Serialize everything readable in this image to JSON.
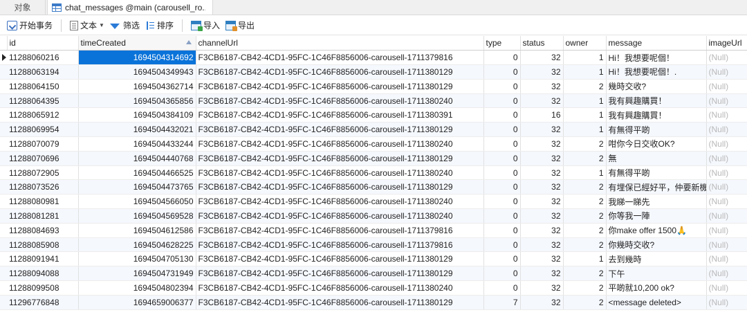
{
  "tabs": {
    "objects_label": "对象",
    "active_label": "chat_messages @main (carousell_ro..."
  },
  "toolbar": {
    "begin_tx": "开始事务",
    "text": "文本",
    "filter": "筛选",
    "sort": "排序",
    "import": "导入",
    "export": "导出"
  },
  "columns": [
    "id",
    "timeCreated",
    "channelUrl",
    "type",
    "status",
    "owner",
    "message",
    "imageUrl"
  ],
  "rows": [
    {
      "id": "11288060216",
      "timeCreated": "1694504314692",
      "channelUrl": "F3CB6187-CB42-4CD1-95FC-1C46F8856006-carousell-1711379816",
      "type": "0",
      "status": "32",
      "owner": "1",
      "message": "Hi！我想要呢個！",
      "imageUrl": "(Null)"
    },
    {
      "id": "11288063194",
      "timeCreated": "1694504349943",
      "channelUrl": "F3CB6187-CB42-4CD1-95FC-1C46F8856006-carousell-1711380129",
      "type": "0",
      "status": "32",
      "owner": "1",
      "message": "Hi！我想要呢個！.",
      "imageUrl": "(Null)"
    },
    {
      "id": "11288064150",
      "timeCreated": "1694504362714",
      "channelUrl": "F3CB6187-CB42-4CD1-95FC-1C46F8856006-carousell-1711380129",
      "type": "0",
      "status": "32",
      "owner": "2",
      "message": "幾時交收?",
      "imageUrl": "(Null)"
    },
    {
      "id": "11288064395",
      "timeCreated": "1694504365856",
      "channelUrl": "F3CB6187-CB42-4CD1-95FC-1C46F8856006-carousell-1711380240",
      "type": "0",
      "status": "32",
      "owner": "1",
      "message": "我有興趣購買！",
      "imageUrl": "(Null)"
    },
    {
      "id": "11288065912",
      "timeCreated": "1694504384109",
      "channelUrl": "F3CB6187-CB42-4CD1-95FC-1C46F8856006-carousell-1711380391",
      "type": "0",
      "status": "16",
      "owner": "1",
      "message": "我有興趣購買！",
      "imageUrl": "(Null)"
    },
    {
      "id": "11288069954",
      "timeCreated": "1694504432021",
      "channelUrl": "F3CB6187-CB42-4CD1-95FC-1C46F8856006-carousell-1711380129",
      "type": "0",
      "status": "32",
      "owner": "1",
      "message": "有無得平啲",
      "imageUrl": "(Null)"
    },
    {
      "id": "11288070079",
      "timeCreated": "1694504433244",
      "channelUrl": "F3CB6187-CB42-4CD1-95FC-1C46F8856006-carousell-1711380240",
      "type": "0",
      "status": "32",
      "owner": "2",
      "message": "咁你今日交收OK?",
      "imageUrl": "(Null)"
    },
    {
      "id": "11288070696",
      "timeCreated": "1694504440768",
      "channelUrl": "F3CB6187-CB42-4CD1-95FC-1C46F8856006-carousell-1711380129",
      "type": "0",
      "status": "32",
      "owner": "2",
      "message": "無",
      "imageUrl": "(Null)"
    },
    {
      "id": "11288072905",
      "timeCreated": "1694504466525",
      "channelUrl": "F3CB6187-CB42-4CD1-95FC-1C46F8856006-carousell-1711380240",
      "type": "0",
      "status": "32",
      "owner": "1",
      "message": "有無得平啲",
      "imageUrl": "(Null)"
    },
    {
      "id": "11288073526",
      "timeCreated": "1694504473765",
      "channelUrl": "F3CB6187-CB42-4CD1-95FC-1C46F8856006-carousell-1711380129",
      "type": "0",
      "status": "32",
      "owner": "2",
      "message": "有埋保已經好平，仲要新機",
      "imageUrl": "(Null)"
    },
    {
      "id": "11288080981",
      "timeCreated": "1694504566050",
      "channelUrl": "F3CB6187-CB42-4CD1-95FC-1C46F8856006-carousell-1711380240",
      "type": "0",
      "status": "32",
      "owner": "2",
      "message": "我睇一睇先",
      "imageUrl": "(Null)"
    },
    {
      "id": "11288081281",
      "timeCreated": "1694504569528",
      "channelUrl": "F3CB6187-CB42-4CD1-95FC-1C46F8856006-carousell-1711380240",
      "type": "0",
      "status": "32",
      "owner": "2",
      "message": "你等我一陣",
      "imageUrl": "(Null)"
    },
    {
      "id": "11288084693",
      "timeCreated": "1694504612586",
      "channelUrl": "F3CB6187-CB42-4CD1-95FC-1C46F8856006-carousell-1711379816",
      "type": "0",
      "status": "32",
      "owner": "2",
      "message": "你make offer 1500🙏",
      "imageUrl": "(Null)"
    },
    {
      "id": "11288085908",
      "timeCreated": "1694504628225",
      "channelUrl": "F3CB6187-CB42-4CD1-95FC-1C46F8856006-carousell-1711379816",
      "type": "0",
      "status": "32",
      "owner": "2",
      "message": "你幾時交收?",
      "imageUrl": "(Null)"
    },
    {
      "id": "11288091941",
      "timeCreated": "1694504705130",
      "channelUrl": "F3CB6187-CB42-4CD1-95FC-1C46F8856006-carousell-1711380129",
      "type": "0",
      "status": "32",
      "owner": "1",
      "message": "去到幾時",
      "imageUrl": "(Null)"
    },
    {
      "id": "11288094088",
      "timeCreated": "1694504731949",
      "channelUrl": "F3CB6187-CB42-4CD1-95FC-1C46F8856006-carousell-1711380129",
      "type": "0",
      "status": "32",
      "owner": "2",
      "message": "下午",
      "imageUrl": "(Null)"
    },
    {
      "id": "11288099508",
      "timeCreated": "1694504802394",
      "channelUrl": "F3CB6187-CB42-4CD1-95FC-1C46F8856006-carousell-1711380240",
      "type": "0",
      "status": "32",
      "owner": "2",
      "message": "平啲就10,200 ok?",
      "imageUrl": "(Null)"
    },
    {
      "id": "11296776848",
      "timeCreated": "1694659006377",
      "channelUrl": "F3CB6187-CB42-4CD1-95FC-1C46F8856006-carousell-1711380129",
      "type": "7",
      "status": "32",
      "owner": "2",
      "message": "<message deleted>",
      "imageUrl": "(Null)"
    }
  ],
  "colors": {
    "selection": "#0a73d9",
    "null_text": "#b8b8b8",
    "alt_row": "#f5f8fd"
  }
}
